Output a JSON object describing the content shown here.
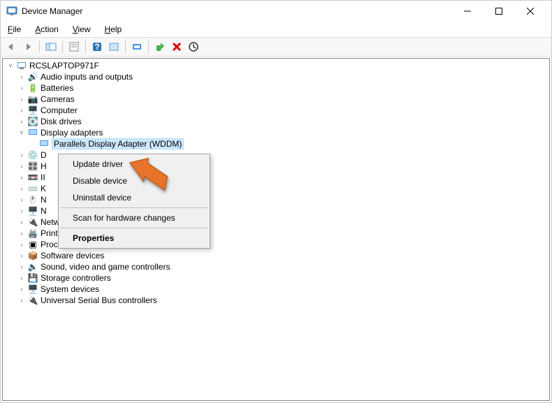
{
  "window": {
    "title": "Device Manager"
  },
  "menubar": {
    "file": "File",
    "action": "Action",
    "view": "View",
    "help": "Help"
  },
  "tree": {
    "root": "RCSLAPTOP971F",
    "items": [
      {
        "label": "Audio inputs and outputs",
        "icon": "audio"
      },
      {
        "label": "Batteries",
        "icon": "battery"
      },
      {
        "label": "Cameras",
        "icon": "camera"
      },
      {
        "label": "Computer",
        "icon": "computer"
      },
      {
        "label": "Disk drives",
        "icon": "disk"
      },
      {
        "label": "Display adapters",
        "icon": "display",
        "expanded": true
      },
      {
        "label": "Parallels Display Adapter (WDDM)",
        "icon": "display",
        "child": true,
        "selected": true
      },
      {
        "label": "D",
        "icon": "drive",
        "truncated": true
      },
      {
        "label": "H",
        "icon": "hid",
        "truncated": true
      },
      {
        "label": "II",
        "icon": "ide",
        "truncated": true
      },
      {
        "label": "K",
        "icon": "keyboard",
        "truncated": true
      },
      {
        "label": "N",
        "icon": "mouse",
        "truncated": true
      },
      {
        "label": "N",
        "icon": "monitor",
        "truncated": true
      },
      {
        "label": "Network adapters",
        "icon": "network"
      },
      {
        "label": "Print queues",
        "icon": "printer"
      },
      {
        "label": "Processors",
        "icon": "cpu"
      },
      {
        "label": "Software devices",
        "icon": "software"
      },
      {
        "label": "Sound, video and game controllers",
        "icon": "sound"
      },
      {
        "label": "Storage controllers",
        "icon": "storage"
      },
      {
        "label": "System devices",
        "icon": "system"
      },
      {
        "label": "Universal Serial Bus controllers",
        "icon": "usb"
      }
    ]
  },
  "context_menu": {
    "update_driver": "Update driver",
    "disable_device": "Disable device",
    "uninstall_device": "Uninstall device",
    "scan_hardware": "Scan for hardware changes",
    "properties": "Properties"
  }
}
